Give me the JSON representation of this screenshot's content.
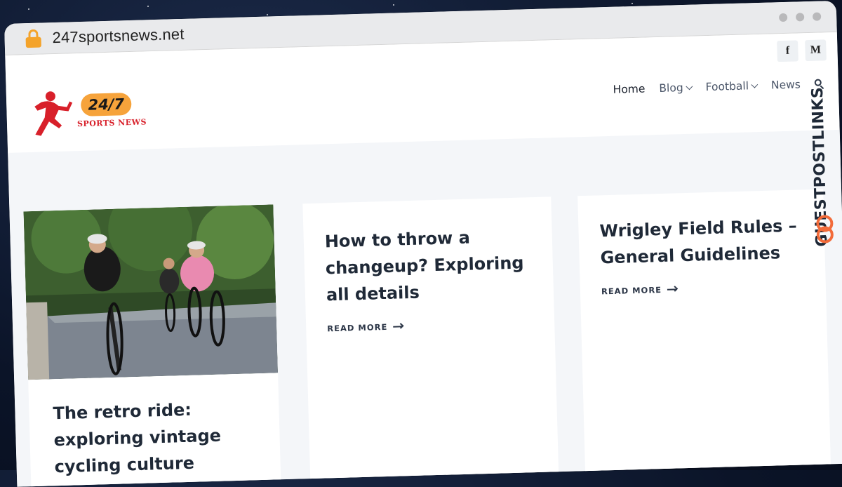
{
  "browser": {
    "url": "247sportsnews.net"
  },
  "social": {
    "facebook": "f",
    "medium": "M"
  },
  "logo": {
    "badge_text": "24/7",
    "tagline": "SPORTS NEWS"
  },
  "nav": {
    "items": [
      {
        "label": "Home",
        "active": true
      },
      {
        "label": "Blog",
        "dropdown": true
      },
      {
        "label": "Football",
        "dropdown": true
      },
      {
        "label": "News"
      }
    ]
  },
  "posts": [
    {
      "title": "The retro ride: exploring vintage cycling culture",
      "has_image": true,
      "image_desc": "cyclists riding on road"
    },
    {
      "title": "How to throw a changeup? Exploring all details",
      "read_more": "READ MORE"
    },
    {
      "title": "Wrigley Field Rules – General Guidelines",
      "read_more": "READ MORE"
    }
  ],
  "watermark": {
    "text": "GUESTPOSTLINKS"
  },
  "colors": {
    "accent_orange": "#f6a33b",
    "logo_red": "#d8202a",
    "lock": "#f4a32a"
  }
}
